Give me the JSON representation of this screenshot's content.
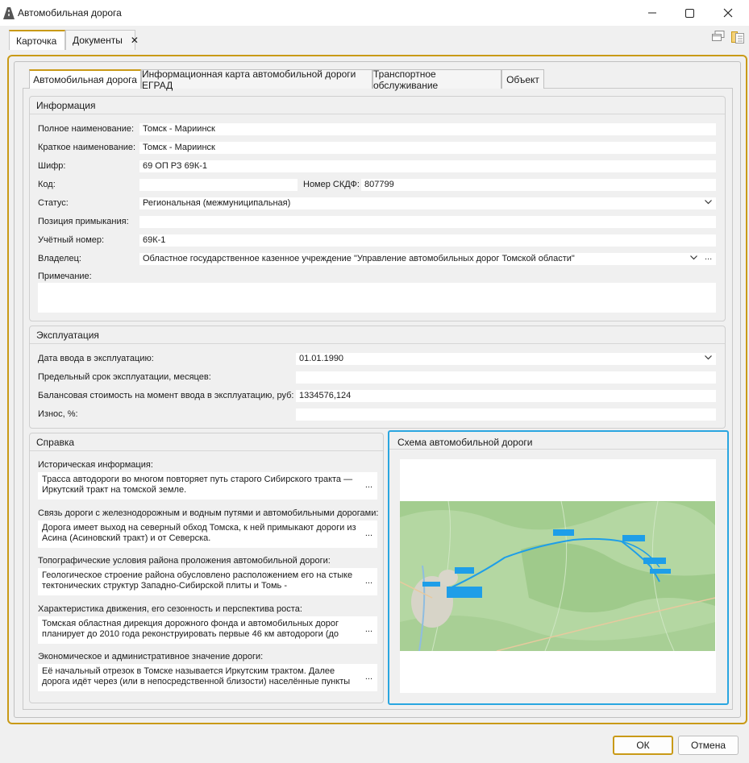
{
  "window": {
    "title": "Автомобильная дорога"
  },
  "top_tabs": {
    "card": "Карточка",
    "documents": "Документы",
    "close_glyph": "✕"
  },
  "inner_tabs": {
    "road": "Автомобильная дорога",
    "egrad": "Информационная карта автомобильной дороги ЕГРАД",
    "transport": "Транспортное обслуживание",
    "object": "Объект"
  },
  "info": {
    "title": "Информация",
    "full_name_label": "Полное наименование:",
    "full_name": "Томск - Мариинск",
    "short_name_label": "Краткое наименование:",
    "short_name": "Томск - Мариинск",
    "cipher_label": "Шифр:",
    "cipher": "69 ОП РЗ 69К-1",
    "code_label": "Код:",
    "code": "",
    "skdf_label": "Номер СКДФ:",
    "skdf": "807799",
    "status_label": "Статус:",
    "status": "Региональная (межмуниципальная)",
    "junction_label": "Позиция примыкания:",
    "junction": "",
    "account_label": "Учётный номер:",
    "account": "69К-1",
    "owner_label": "Владелец:",
    "owner": "Областное государственное казенное учреждение \"Управление автомобильных дорог Томской области\"",
    "note_label": "Примечание:",
    "note": ""
  },
  "exploitation": {
    "title": "Эксплуатация",
    "date_label": "Дата ввода в эксплуатацию:",
    "date": "01.01.1990",
    "limit_label": "Предельный срок эксплуатации, месяцев:",
    "limit": "",
    "balance_label": "Балансовая стоимость на момент ввода в эксплуатацию, руб:",
    "balance": "1334576,124",
    "wear_label": "Износ, %:",
    "wear": ""
  },
  "spravka": {
    "title": "Справка",
    "items": [
      {
        "label": "Историческая информация:",
        "text": "Трасса автодороги во многом повторяет путь старого Сибирского тракта — Иркутский тракт на томской земле."
      },
      {
        "label": "Связь дороги с железнодорожным и водным путями и автомобильными дорогами:",
        "text": "Дорога имеет выход на северный обход Томска, к ней примыкают дороги из Асина (Асиновский тракт) и от Северска."
      },
      {
        "label": "Топографические условия района проложения автомобильной дороги:",
        "text": "Геологическое строение района обусловлено расположением его на стыке тектонических структур Западно-Сибирской плиты и Томь -"
      },
      {
        "label": "Характеристика движения, его сезонность и перспектива роста:",
        "text": "Томская областная дирекция дорожного фонда и автомобильных дорог планирует до 2010 года реконструировать первые 46 км автодороги (до"
      },
      {
        "label": "Экономическое и административное значение дороги:",
        "text": " Её начальный отрезок в Томске называется Иркутским трактом. Далее дорога идёт через (или в непосредственной близости) населённые пункты"
      }
    ],
    "dots": "..."
  },
  "schema": {
    "title": "Схема автомобильной дороги"
  },
  "buttons": {
    "ok": "ОК",
    "cancel": "Отмена"
  },
  "colors": {
    "accent": "#c99a17",
    "selection": "#2aa6e0",
    "map_green": "#a9cf96",
    "route": "#1e9ee8"
  }
}
